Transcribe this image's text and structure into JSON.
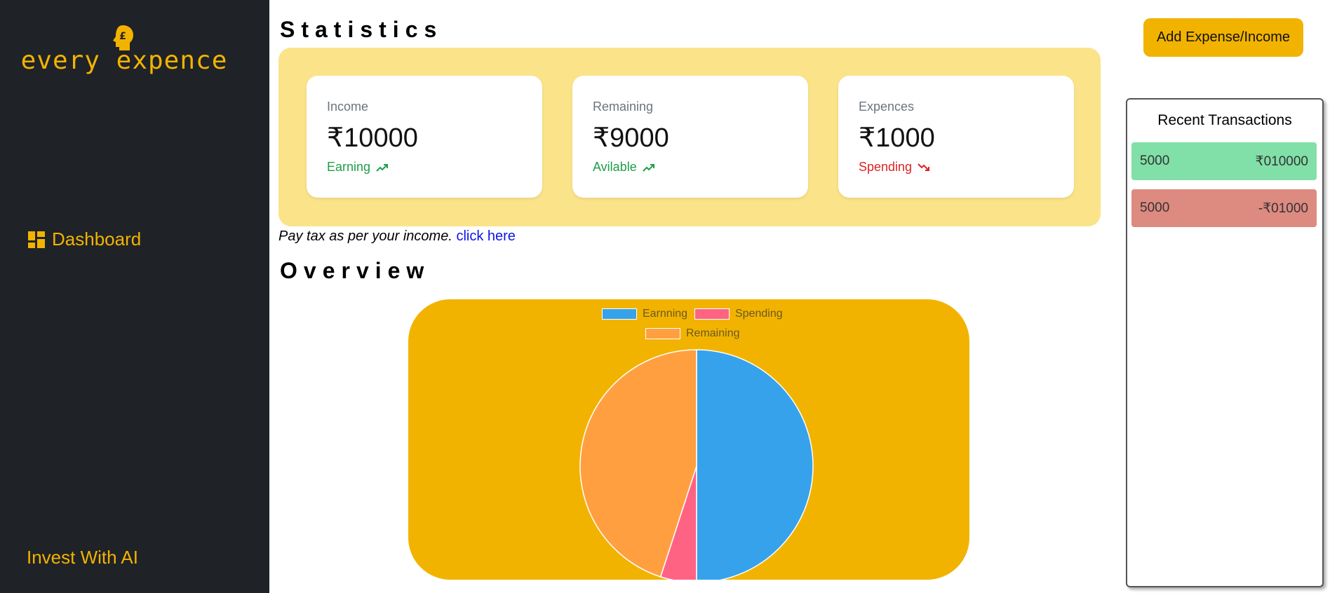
{
  "sidebar": {
    "logo_text": "every expence",
    "nav": [
      {
        "label": "Dashboard",
        "icon": "grid-icon"
      }
    ],
    "footer_link": "Invest With AI"
  },
  "statistics": {
    "title": "Statistics",
    "cards": [
      {
        "label": "Income",
        "value": "₹10000",
        "trend": "Earning",
        "trend_icon": "trend-up-icon",
        "trend_color": "#1e9e4a"
      },
      {
        "label": "Remaining",
        "value": "₹9000",
        "trend": "Avilable",
        "trend_icon": "trend-up-icon",
        "trend_color": "#1e9e4a"
      },
      {
        "label": "Expences",
        "value": "₹1000",
        "trend": "Spending",
        "trend_icon": "trend-down-icon",
        "trend_color": "#dc2323"
      }
    ]
  },
  "tax_note": {
    "text": "Pay tax as per your income.",
    "link": "click here"
  },
  "overview": {
    "title": "Overview"
  },
  "chart_data": {
    "type": "pie",
    "labels": [
      "Earnning",
      "Spending",
      "Remaining"
    ],
    "values": [
      10000,
      1000,
      9000
    ],
    "colors": [
      "#36a2eb",
      "#ff6384",
      "#ff9f40"
    ],
    "legend": "top"
  },
  "actions": {
    "add_button": "Add Expense/Income"
  },
  "recent": {
    "title": "Recent Transactions",
    "items": [
      {
        "left": "5000",
        "right": "₹010000",
        "color": "#80e0a7"
      },
      {
        "left": "5000",
        "right": "-₹01000",
        "color": "#dd8a80"
      }
    ]
  },
  "colors": {
    "accent": "#f2b300",
    "sidebar_bg": "#1f2227",
    "stats_panel": "#fbe38a"
  }
}
